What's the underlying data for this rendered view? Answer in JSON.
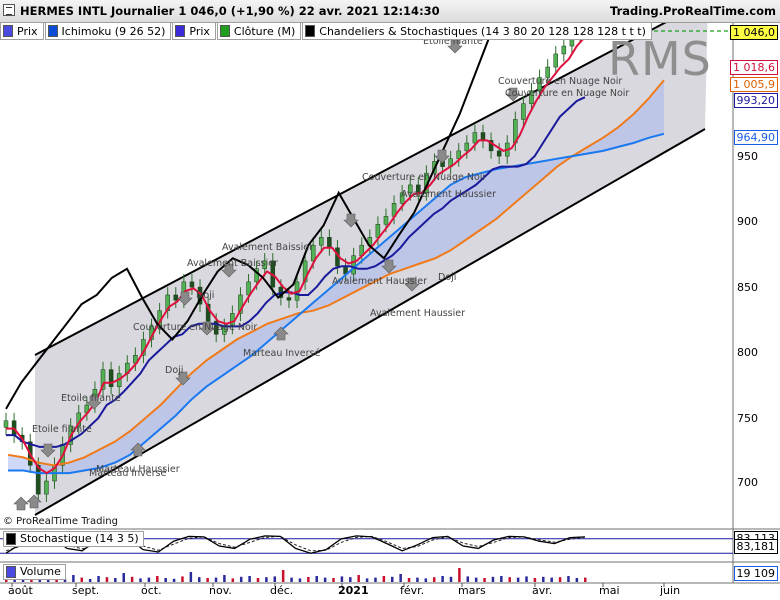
{
  "titlebar": {
    "title": "HERMES INTL Journalier 1 046,0 (+1,90 %) 22 avr. 2021 12:14:30",
    "brand": "Trading.ProRealTime.com"
  },
  "legend": [
    {
      "label": "Prix",
      "color": "#4a4ae0"
    },
    {
      "label": "Ichimoku (9 26 52)",
      "color": "#0b4bd6"
    },
    {
      "label": "Prix",
      "color": "#3a2ad8"
    },
    {
      "label": "Clôture (M)",
      "color": "#1e9e1e"
    },
    {
      "label": "Chandeliers & Stochastiques (14 3 80 20 128 128 128 t t t)",
      "color": "#000000"
    }
  ],
  "watermark": "RMS",
  "copyright": "© ProRealTime Trading",
  "price_tags": [
    {
      "value": "1 046,0",
      "bg": "#ffff44",
      "fg": "#000000",
      "border": "#000000"
    },
    {
      "value": "1 018,6",
      "bg": "#ffffff",
      "fg": "#d0103a",
      "border": "#d0103a"
    },
    {
      "value": "1 005,9",
      "bg": "#ffffff",
      "fg": "#e06000",
      "border": "#e06000"
    },
    {
      "value": "993,20",
      "bg": "#ffffff",
      "fg": "#1a1a9c",
      "border": "#1a1a9c"
    },
    {
      "value": "964,90",
      "bg": "#ffffff",
      "fg": "#1a5ee8",
      "border": "#1a5ee8"
    }
  ],
  "y_ticks": [
    "950",
    "900",
    "850",
    "800",
    "750",
    "700"
  ],
  "x_ticks": [
    "août",
    "sept.",
    "oct.",
    "nov.",
    "déc.",
    "2021",
    "févr.",
    "mars",
    "avr.",
    "mai",
    "juin"
  ],
  "patterns": [
    "Etoile filante",
    "Couverture en Nuage Noir",
    "Couverture en Nuage Noir",
    "Doji",
    "Couverture en Nuage Noir",
    "Etoile filante",
    "Avalement Baissier",
    "Avalement Baissier",
    "Doji",
    "Couverture en Nuage Noir",
    "Marteau Inversé",
    "Avalement Haussier",
    "Avalement Haussier",
    "Marteau Inversé",
    "Etoile filante",
    "Avalement Haussier",
    "Marteau Haussier",
    "Doji"
  ],
  "stochastic": {
    "label": "Stochastique (14 3 5)",
    "value1": "83,113",
    "value2": "83,181"
  },
  "volume": {
    "label": "Volume",
    "value": "19 109"
  },
  "chart_data": {
    "type": "candlestick",
    "title": "HERMES INTL Journalier",
    "ylim": [
      675,
      1060
    ],
    "close": [
      746,
      735,
      730,
      712,
      690,
      700,
      712,
      728,
      742,
      752,
      758,
      770,
      785,
      772,
      782,
      790,
      796,
      808,
      818,
      830,
      842,
      838,
      852,
      848,
      835,
      822,
      812,
      818,
      828,
      842,
      852,
      862,
      868,
      848,
      840,
      838,
      852,
      868,
      880,
      886,
      878,
      864,
      858,
      872,
      880,
      886,
      896,
      902,
      912,
      920,
      926,
      920,
      935,
      944,
      940,
      946,
      952,
      958,
      966,
      960,
      952,
      948,
      958,
      976,
      988,
      998,
      1008,
      1016,
      1026,
      1032,
      1040,
      1046
    ],
    "tenkan": [
      740,
      740,
      732,
      720,
      710,
      706,
      710,
      720,
      735,
      745,
      752,
      760,
      775,
      775,
      778,
      783,
      790,
      800,
      812,
      823,
      833,
      837,
      845,
      847,
      842,
      830,
      822,
      820,
      822,
      833,
      843,
      852,
      860,
      856,
      848,
      843,
      845,
      858,
      870,
      878,
      878,
      870,
      866,
      868,
      874,
      880,
      888,
      896,
      905,
      913,
      919,
      920,
      926,
      934,
      938,
      942,
      948,
      953,
      960,
      960,
      956,
      952,
      954,
      964,
      978,
      990,
      1000,
      1008,
      1016,
      1022,
      1032,
      1039
    ],
    "kijun": [
      735,
      735,
      730,
      728,
      726,
      726,
      726,
      728,
      732,
      736,
      742,
      748,
      758,
      762,
      768,
      775,
      782,
      792,
      798,
      804,
      810,
      812,
      818,
      820,
      820,
      820,
      818,
      818,
      818,
      822,
      828,
      836,
      842,
      844,
      844,
      842,
      842,
      848,
      856,
      862,
      864,
      864,
      862,
      862,
      864,
      868,
      872,
      878,
      886,
      892,
      898,
      904,
      908,
      914,
      918,
      922,
      926,
      932,
      938,
      940,
      940,
      940,
      942,
      948,
      958,
      968,
      978,
      984,
      990,
      993
    ],
    "chikou": [
      755,
      775,
      790,
      805,
      820,
      835,
      842,
      855,
      862,
      840,
      820,
      808,
      822,
      842,
      860,
      870,
      865,
      855,
      840,
      850,
      880,
      895,
      920,
      900,
      880,
      870,
      888,
      905,
      930,
      955,
      980,
      1010,
      1040,
      1046
    ],
    "senkou_a": [
      720,
      718,
      714,
      712,
      714,
      718,
      724,
      730,
      738,
      748,
      758,
      770,
      782,
      792,
      800,
      808,
      814,
      820,
      824,
      828,
      830,
      834,
      840,
      846,
      852,
      858,
      862,
      866,
      870,
      876,
      884,
      892,
      900,
      910,
      920,
      930,
      940,
      948,
      955,
      962,
      970,
      980,
      992,
      1006
    ],
    "senkou_b": [
      708,
      708,
      706,
      706,
      706,
      708,
      710,
      714,
      720,
      730,
      740,
      750,
      762,
      772,
      780,
      788,
      796,
      806,
      816,
      826,
      836,
      846,
      856,
      866,
      876,
      886,
      896,
      906,
      916,
      926,
      932,
      935,
      938,
      940,
      942,
      944,
      946,
      948,
      950,
      952,
      955,
      958,
      962,
      965
    ],
    "channel": {
      "upper": [
        [
          35,
          355
        ],
        [
          708,
          0
        ]
      ],
      "lower": [
        [
          35,
          515
        ],
        [
          705,
          129
        ]
      ]
    },
    "stochastic_k": [
      20,
      60,
      85,
      90,
      40,
      30,
      75,
      92,
      85,
      35,
      25,
      70,
      90,
      88,
      50,
      40,
      78,
      92,
      90,
      40,
      20,
      35,
      80,
      92,
      88,
      60,
      30,
      55,
      85,
      90,
      50,
      40,
      75,
      90,
      88,
      70,
      60,
      85,
      88
    ],
    "stochastic_d": [
      30,
      50,
      75,
      85,
      55,
      38,
      60,
      85,
      86,
      50,
      32,
      58,
      82,
      88,
      60,
      45,
      65,
      86,
      90,
      55,
      30,
      32,
      65,
      86,
      90,
      68,
      40,
      48,
      75,
      88,
      62,
      48,
      65,
      85,
      88,
      76,
      66,
      78,
      87
    ],
    "volume": [
      30,
      22,
      18,
      40,
      25,
      28,
      20,
      18,
      35,
      22,
      15,
      30,
      24,
      20,
      45,
      26,
      18,
      22,
      30,
      20,
      16,
      28,
      50,
      24,
      20,
      22,
      35,
      18,
      26,
      30,
      20,
      24,
      28,
      60,
      22,
      18,
      25,
      30,
      22,
      20,
      28,
      24,
      35,
      18,
      22,
      30,
      26,
      40,
      20,
      22,
      18,
      24,
      30,
      26,
      70,
      28,
      22,
      20,
      26,
      30,
      24,
      22,
      28,
      20,
      26,
      22,
      24,
      30,
      20,
      22
    ]
  }
}
